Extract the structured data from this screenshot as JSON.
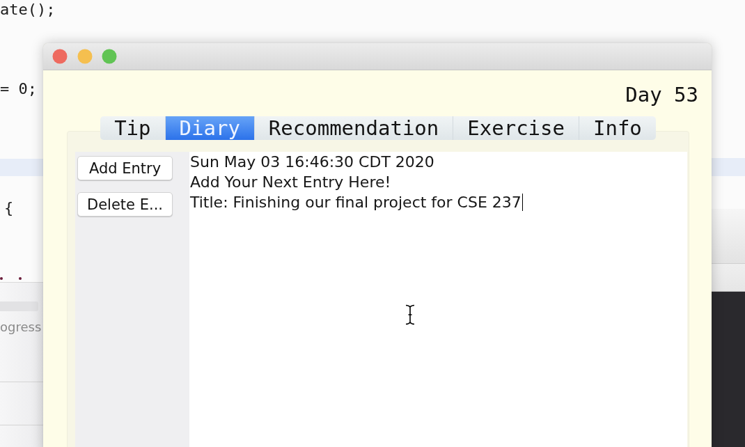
{
  "editor": {
    "code_lines": [
      "ate();",
      "= 0;",
      "{"
    ],
    "panel_label": "ogress"
  },
  "window": {
    "day_label": "Day 53",
    "tabs": [
      {
        "label": "Tip",
        "selected": false
      },
      {
        "label": "Diary",
        "selected": true
      },
      {
        "label": "Recommendation",
        "selected": false
      },
      {
        "label": "Exercise",
        "selected": false
      },
      {
        "label": "Info",
        "selected": false
      }
    ],
    "diary": {
      "buttons": [
        {
          "label": "Add Entry"
        },
        {
          "label": "Delete E..."
        }
      ],
      "text_area": {
        "lines": [
          "Sun May 03 16:46:30 CDT 2020",
          "Add Your Next Entry Here!",
          "Title: Finishing our final project for CSE 237"
        ],
        "focused": true
      }
    }
  }
}
